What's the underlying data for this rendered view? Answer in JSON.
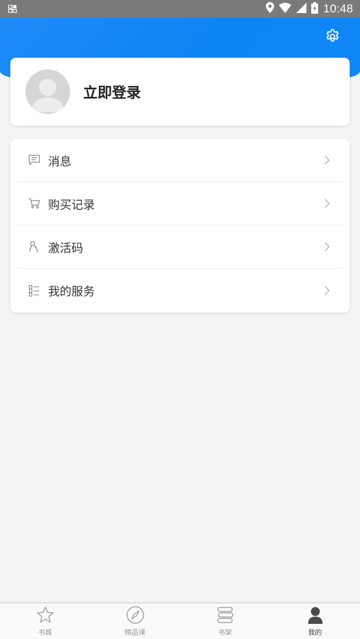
{
  "status_bar": {
    "time": "10:48",
    "icons": [
      "notification-icon",
      "location-icon",
      "wifi-icon",
      "signal-icon",
      "battery-icon"
    ]
  },
  "header": {
    "settings_icon": "gear-icon",
    "accent_color": "#0d84f4"
  },
  "profile": {
    "login_label": "立即登录",
    "avatar_icon": "default-avatar"
  },
  "menu": {
    "items": [
      {
        "label": "消息",
        "icon": "message-icon"
      },
      {
        "label": "购买记录",
        "icon": "cart-icon"
      },
      {
        "label": "激活码",
        "icon": "key-icon"
      },
      {
        "label": "我的服务",
        "icon": "service-list-icon"
      }
    ]
  },
  "tab_bar": {
    "tabs": [
      {
        "label": "书城",
        "icon": "star-icon",
        "active": false
      },
      {
        "label": "精品课",
        "icon": "compass-icon",
        "active": false
      },
      {
        "label": "书架",
        "icon": "bookshelf-icon",
        "active": false
      },
      {
        "label": "我的",
        "icon": "user-icon",
        "active": true
      }
    ]
  }
}
